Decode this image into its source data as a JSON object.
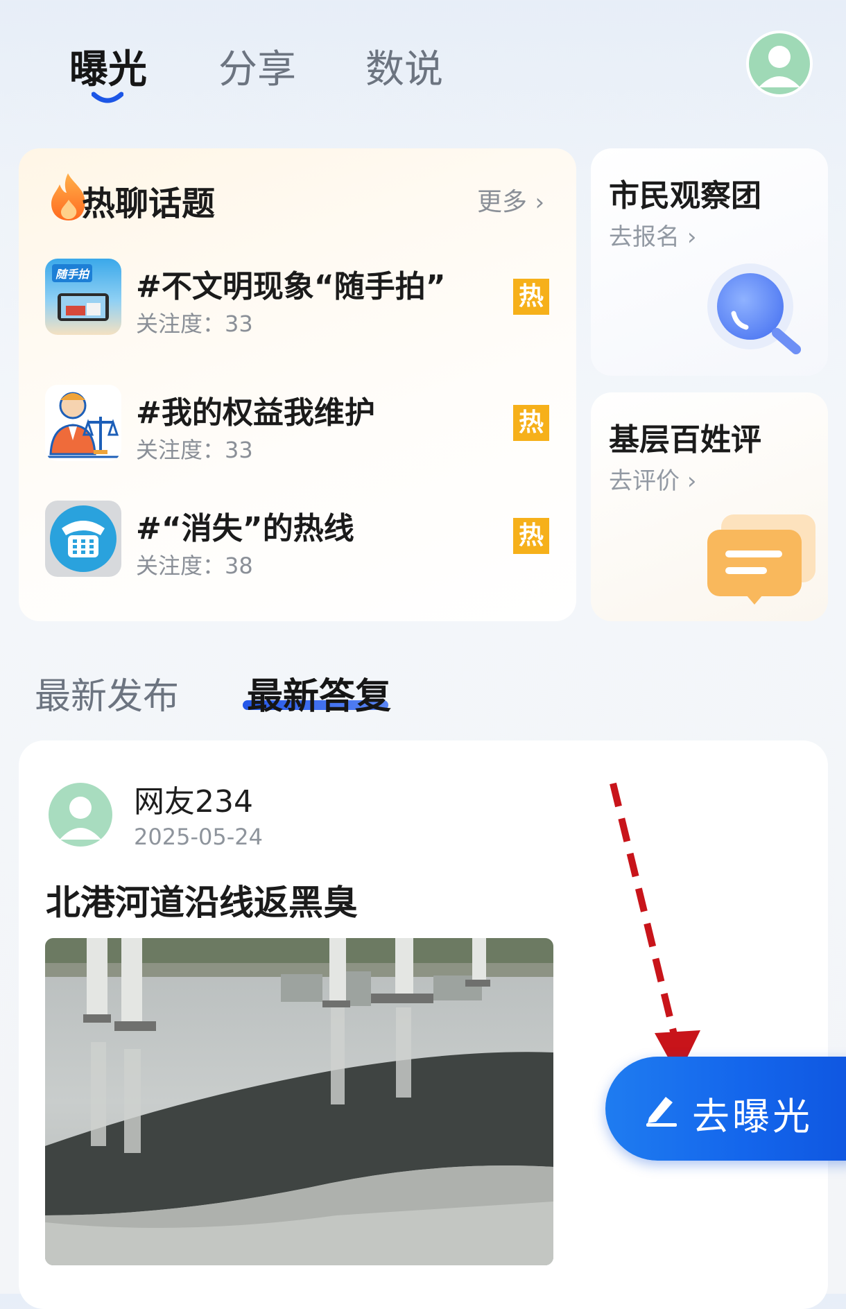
{
  "tabs": [
    {
      "label": "曝光",
      "active": true
    },
    {
      "label": "分享",
      "active": false
    },
    {
      "label": "数说",
      "active": false
    }
  ],
  "hot_topics": {
    "title": "热聊话题",
    "more_label": "更多",
    "items": [
      {
        "title": "#不文明现象“随手拍”",
        "meta": "关注度：33",
        "badge": "热",
        "thumb_text": "随手拍"
      },
      {
        "title": "#我的权益我维护",
        "meta": "关注度：33",
        "badge": "热"
      },
      {
        "title": "#“消失”的热线",
        "meta": "关注度：38",
        "badge": "热"
      }
    ]
  },
  "side_cards": [
    {
      "title": "市民观察团",
      "link": "去报名",
      "icon": "magnifier-icon"
    },
    {
      "title": "基层百姓评",
      "link": "去评价",
      "icon": "chat-bubble-icon"
    }
  ],
  "section_tabs": [
    {
      "label": "最新发布",
      "active": false
    },
    {
      "label": "最新答复",
      "active": true
    }
  ],
  "post": {
    "user": "网友234",
    "date": "2025-05-24",
    "title": "北港河道沿线返黑臭"
  },
  "fab": {
    "label": "去曝光",
    "icon": "edit-pen-icon"
  },
  "colors": {
    "accent": "#1f6ef0",
    "hot_badge": "#f6b01a",
    "annotation_arrow": "#c8141a"
  }
}
